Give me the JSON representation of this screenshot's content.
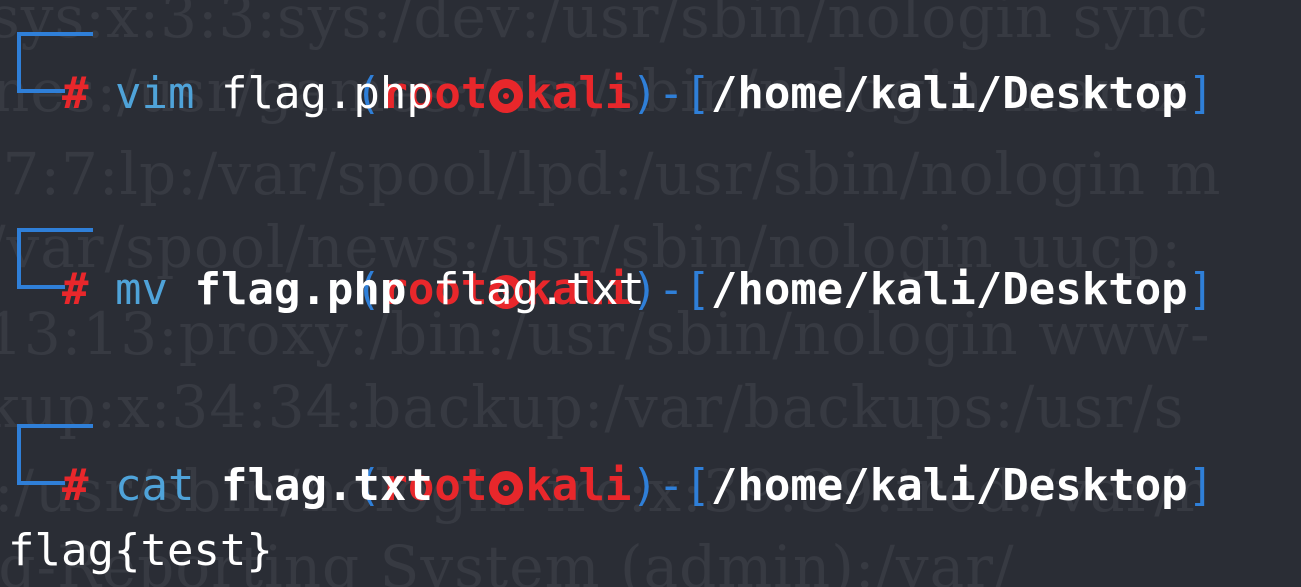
{
  "window": {
    "background_color": "#2a2d35",
    "accent_color": "#2f7fd8",
    "prompt_color": "#e8272b"
  },
  "background_watermark": [
    "sys:x:3:3:sys:/dev:/usr/sbin/nologin sync",
    "nes:/usr/games:/usr/sbin/nologin man:x",
    ":7:7:lp:/var/spool/lpd:/usr/sbin/nologin m",
    "/var/spool/news:/usr/sbin/nologin uucp:",
    "13:13:proxy:/bin:/usr/sbin/nologin www-",
    "kup:x:34:34:backup:/var/backups:/usr/s",
    ":/usr/sbin/nologin irc:x:39:39:ircd:/var/r",
    "ug-Reporting System (admin):/var/"
  ],
  "prompt": {
    "open_paren": "(",
    "user": "root",
    "skull_icon": "kali-skull-icon",
    "host": "kali",
    "close_paren": ")",
    "dash": "-",
    "open_bracket": "[",
    "path": "/home/kali/Desktop",
    "close_bracket": "]",
    "hash": "#"
  },
  "commands": [
    {
      "cmd": "vim",
      "args": [
        {
          "text": "flag.php",
          "bold": false
        }
      ]
    },
    {
      "cmd": "mv",
      "args": [
        {
          "text": "flag.php",
          "bold": true
        },
        {
          "text": "flag.txt",
          "bold": false
        }
      ]
    },
    {
      "cmd": "cat",
      "args": [
        {
          "text": "flag.txt",
          "bold": true
        }
      ]
    }
  ],
  "output": {
    "text": "flag{test}"
  }
}
